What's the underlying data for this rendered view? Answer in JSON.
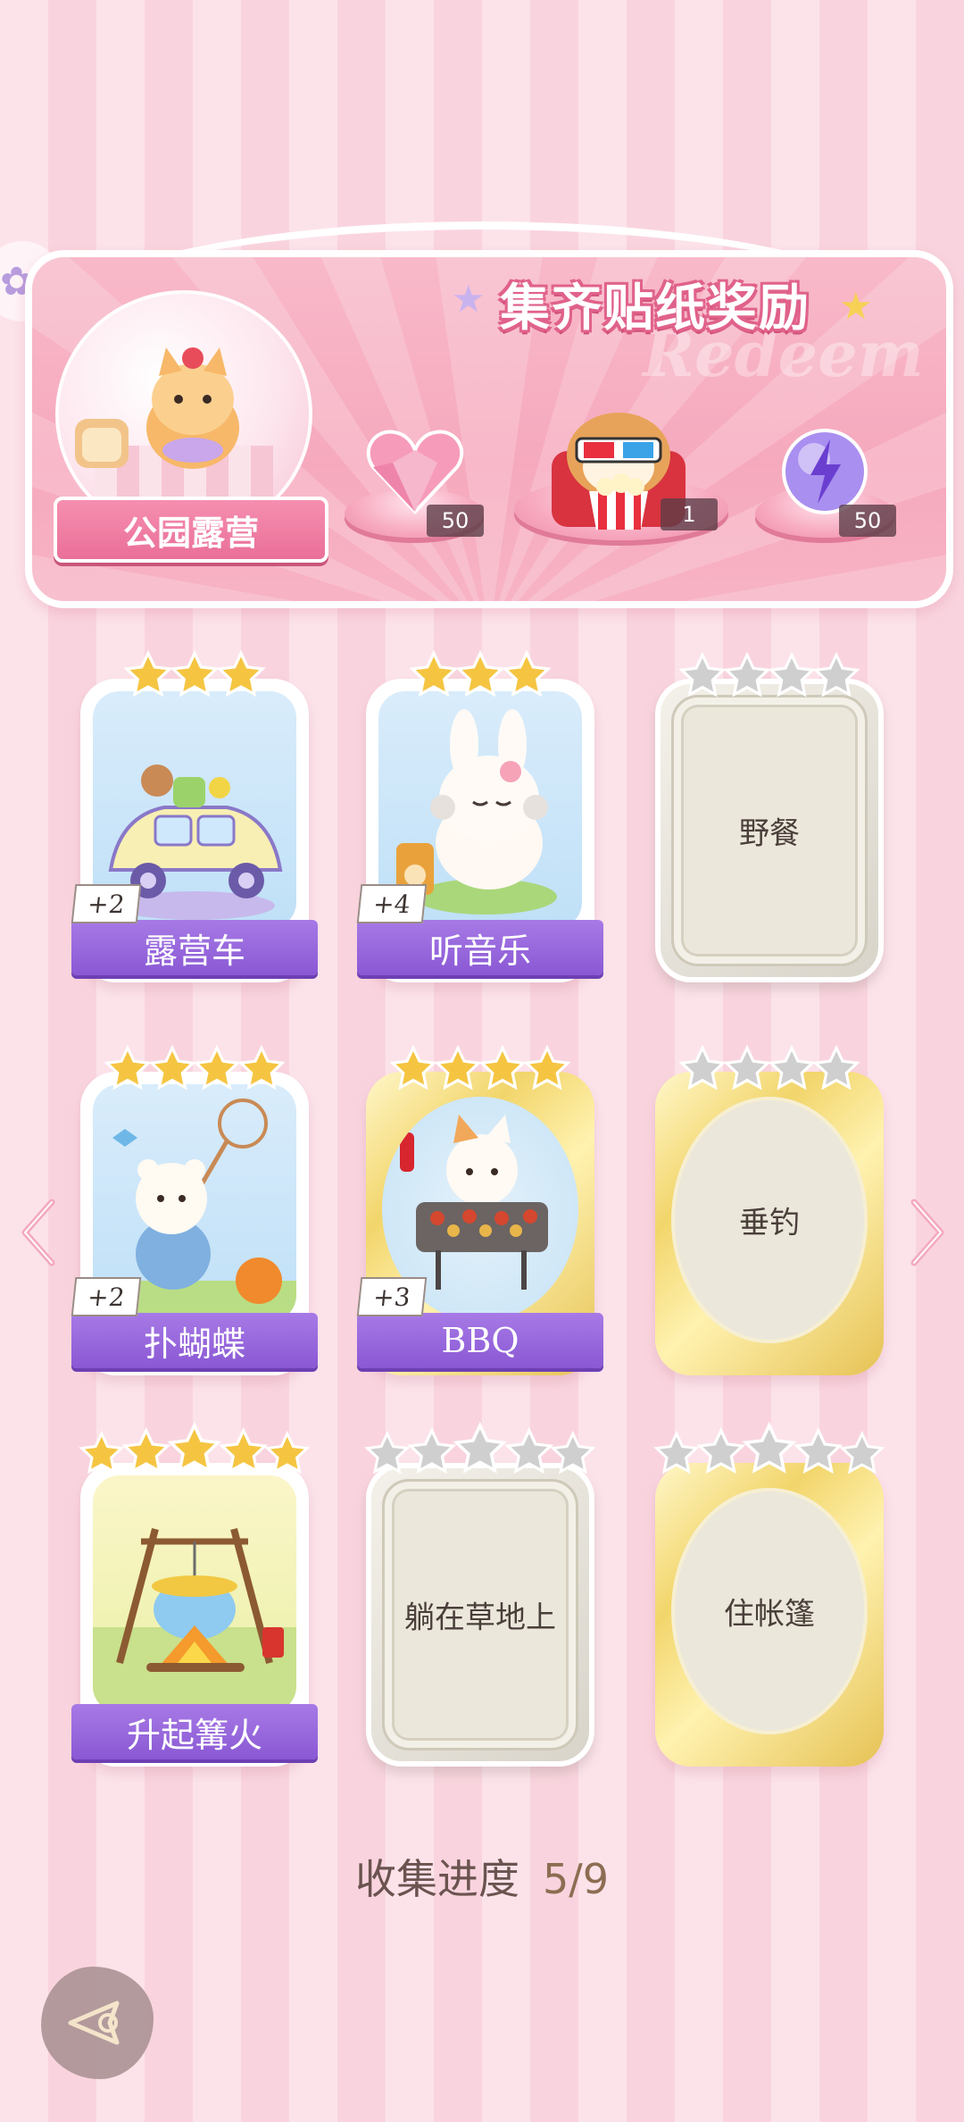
{
  "banner": {
    "title": "集齐贴纸奖励",
    "watermark": "Redeem",
    "theme_name": "公园露营",
    "rewards": [
      {
        "icon": "pink-heart-gem-icon",
        "count": "50"
      },
      {
        "icon": "popcorn-cat-avatar-icon",
        "count": "1"
      },
      {
        "icon": "lightning-energy-orb-icon",
        "count": "50"
      }
    ]
  },
  "stickers": [
    {
      "name": "露营车",
      "stars": 3,
      "bonus": "+2",
      "unlocked": true
    },
    {
      "name": "听音乐",
      "stars": 3,
      "bonus": "+4",
      "unlocked": true
    },
    {
      "name": "野餐",
      "stars": 4,
      "unlocked": false
    },
    {
      "name": "扑蝴蝶",
      "stars": 4,
      "bonus": "+2",
      "unlocked": true
    },
    {
      "name": "BBQ",
      "stars": 4,
      "bonus": "+3",
      "unlocked": true
    },
    {
      "name": "垂钓",
      "stars": 4,
      "unlocked": false
    },
    {
      "name": "升起篝火",
      "stars": 5,
      "unlocked": true
    },
    {
      "name": "躺在草地上",
      "stars": 5,
      "unlocked": false
    },
    {
      "name": "住帐篷",
      "stars": 5,
      "unlocked": false
    }
  ],
  "progress": {
    "label": "收集进度",
    "value": "5/9"
  },
  "colors": {
    "accent_purple": "#8a58d4",
    "banner_pink": "#f6a9bd",
    "star_gold": "#f5c542",
    "star_silver": "#c9c9c9"
  }
}
